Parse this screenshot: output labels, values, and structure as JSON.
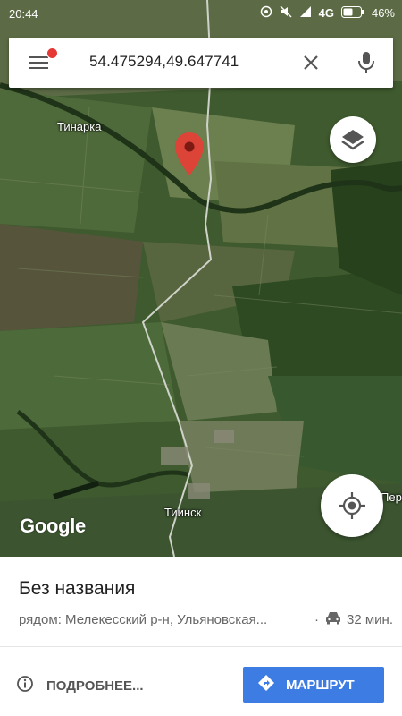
{
  "status_bar": {
    "time": "20:44",
    "network": "4G",
    "battery": "46%",
    "icons": [
      "hotspot-icon",
      "mute-icon",
      "signal-icon",
      "battery-icon"
    ]
  },
  "search": {
    "query": "54.475294,49.647741",
    "menu_icon": "hamburger-menu-icon",
    "clear_icon": "close-icon",
    "voice_icon": "microphone-icon"
  },
  "map": {
    "places": {
      "tinarka": "Тинарка",
      "tiinsk": "Тиинск",
      "edge_label": "Пере"
    },
    "logo": "Google",
    "pin_color": "#db4437",
    "layers_icon": "layers-icon",
    "my_location_icon": "my-location-icon"
  },
  "place_sheet": {
    "title": "Без названия",
    "subtitle": "рядом: Мелекесский р-н, Ульяновская...",
    "separator": "·",
    "travel_time": "32 мин.",
    "travel_icon": "car-icon"
  },
  "actions": {
    "details_label": "ПОДРОБНЕЕ...",
    "details_icon": "info-icon",
    "route_label": "МАРШРУТ",
    "route_icon": "directions-icon",
    "accent_color": "#3d7de3"
  }
}
